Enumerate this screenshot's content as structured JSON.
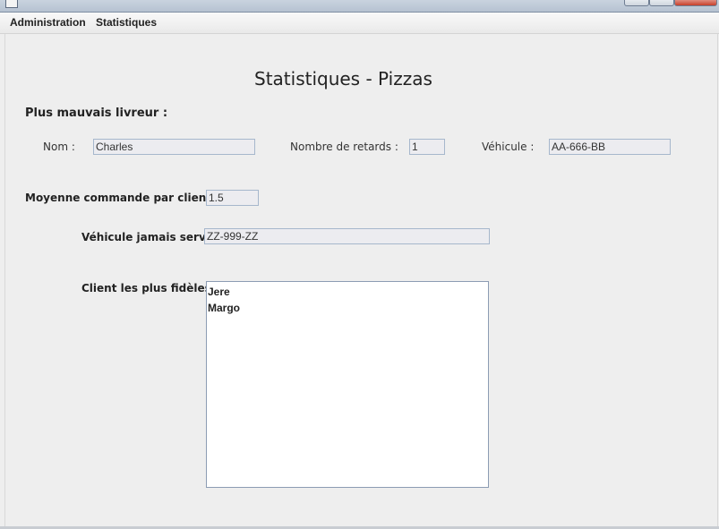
{
  "menu": {
    "items": [
      "Administration",
      "Statistiques"
    ]
  },
  "page_title": "Statistiques - Pizzas",
  "worst_driver": {
    "section_title": "Plus mauvais livreur :",
    "name_label": "Nom :",
    "name_value": "Charles",
    "delays_label": "Nombre de retards :",
    "delays_value": "1",
    "vehicle_label": "Véhicule :",
    "vehicle_value": "AA-666-BB"
  },
  "average_orders": {
    "label": "Moyenne commande par client :",
    "value": "1.5"
  },
  "unused_vehicle": {
    "label": "Véhicule jamais servi :",
    "value": "ZZ-999-ZZ"
  },
  "loyal_clients": {
    "label": "Client les plus fidèles :",
    "items": [
      "Jere",
      "Margo"
    ]
  }
}
